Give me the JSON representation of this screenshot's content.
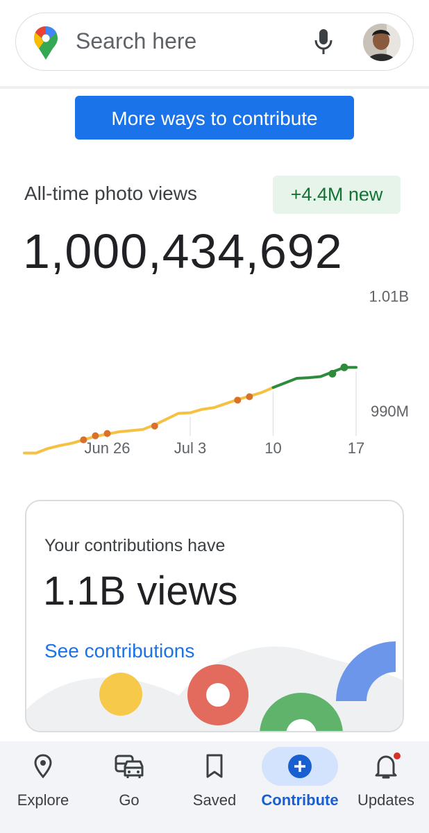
{
  "search": {
    "placeholder": "Search here",
    "icons": [
      "maps-pin-icon",
      "microphone-icon",
      "profile-avatar"
    ]
  },
  "contribute_button": {
    "label": "More ways to contribute"
  },
  "stats": {
    "label": "All-time photo views",
    "badge": "+4.4M new",
    "total": "1,000,434,692"
  },
  "chart_data": {
    "type": "line",
    "x_tick_labels": [
      "Jun 26",
      "Jul 3",
      "10",
      "17"
    ],
    "y_tick_labels": [
      "1.01B",
      "990M"
    ],
    "ylim": [
      980000000,
      1012000000
    ],
    "colors": {
      "line": "#f6c142",
      "recent": "#2e8b3c",
      "milestone_past": "#d8722a",
      "milestone_recent": "#2e8b3c"
    },
    "series": [
      {
        "x": [
          "Jun 19",
          "Jun 20",
          "Jun 21",
          "Jun 22",
          "Jun 23",
          "Jun 24",
          "Jun 25",
          "Jun 26",
          "Jun 27",
          "Jun 28",
          "Jun 29",
          "Jun 30",
          "Jul 1",
          "Jul 2",
          "Jul 3",
          "Jul 4",
          "Jul 5",
          "Jul 6",
          "Jul 7",
          "Jul 8",
          "Jul 9",
          "Jul 10",
          "Jul 11",
          "Jul 12",
          "Jul 13",
          "Jul 14",
          "Jul 15",
          "Jul 16",
          "Jul 17"
        ],
        "values": [
          982700000,
          982700000,
          983500000,
          984000000,
          984400000,
          985000000,
          985600000,
          986000000,
          986400000,
          986600000,
          986800000,
          987600000,
          988600000,
          989600000,
          989700000,
          990300000,
          990600000,
          991300000,
          992000000,
          992600000,
          993200000,
          994100000,
          994900000,
          995700000,
          995800000,
          996000000,
          996800000,
          997600000,
          997600000
        ]
      }
    ],
    "milestones": [
      {
        "x": "Jun 24",
        "value": 985000000,
        "color": "#d8722a"
      },
      {
        "x": "Jun 25",
        "value": 985700000,
        "color": "#d8722a"
      },
      {
        "x": "Jun 26",
        "value": 986100000,
        "color": "#d8722a"
      },
      {
        "x": "Jun 30",
        "value": 987400000,
        "color": "#d8722a"
      },
      {
        "x": "Jul 7",
        "value": 991900000,
        "color": "#d8722a"
      },
      {
        "x": "Jul 8",
        "value": 992500000,
        "color": "#d8722a"
      },
      {
        "x": "Jul 15",
        "value": 996500000,
        "color": "#2e8b3c"
      },
      {
        "x": "Jul 16",
        "value": 997600000,
        "color": "#2e8b3c"
      }
    ],
    "recent_from": "Jul 10"
  },
  "contributions_card": {
    "eyebrow": "Your contributions have",
    "headline": "1.1B views",
    "link": "See contributions"
  },
  "bottom_nav": {
    "items": [
      {
        "label": "Explore",
        "icon": "location-pin-icon"
      },
      {
        "label": "Go",
        "icon": "commute-car-icon"
      },
      {
        "label": "Saved",
        "icon": "bookmark-icon"
      },
      {
        "label": "Contribute",
        "icon": "add-circle-icon",
        "active": true
      },
      {
        "label": "Updates",
        "icon": "notification-bell-icon",
        "has_dot": true
      }
    ]
  }
}
